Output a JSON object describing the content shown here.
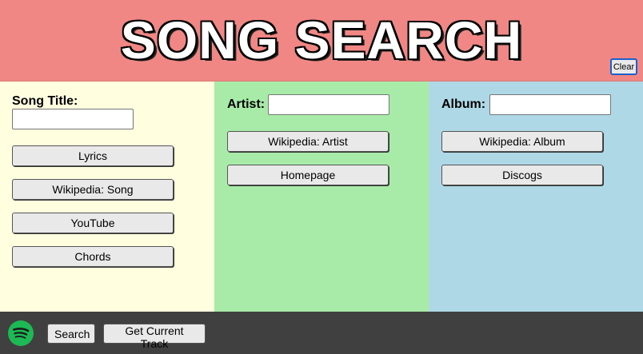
{
  "header": {
    "title": "SONG SEARCH",
    "clear_label": "Clear"
  },
  "song_column": {
    "label": "Song Title:",
    "input_value": "",
    "buttons": [
      "Lyrics",
      "Wikipedia: Song",
      "YouTube",
      "Chords"
    ]
  },
  "artist_column": {
    "label": "Artist:",
    "input_value": "",
    "buttons": [
      "Wikipedia: Artist",
      "Homepage"
    ]
  },
  "album_column": {
    "label": "Album:",
    "input_value": "",
    "buttons": [
      "Wikipedia: Album",
      "Discogs"
    ]
  },
  "footer": {
    "icon": "spotify-icon",
    "search_label": "Search",
    "current_track_label": "Get Current Track"
  },
  "colors": {
    "header": "#f08784",
    "song_column": "#ffffe0",
    "artist_column": "#a8eba8",
    "album_column": "#aed8e6",
    "footer": "#404040",
    "spotify_green": "#1db954"
  }
}
